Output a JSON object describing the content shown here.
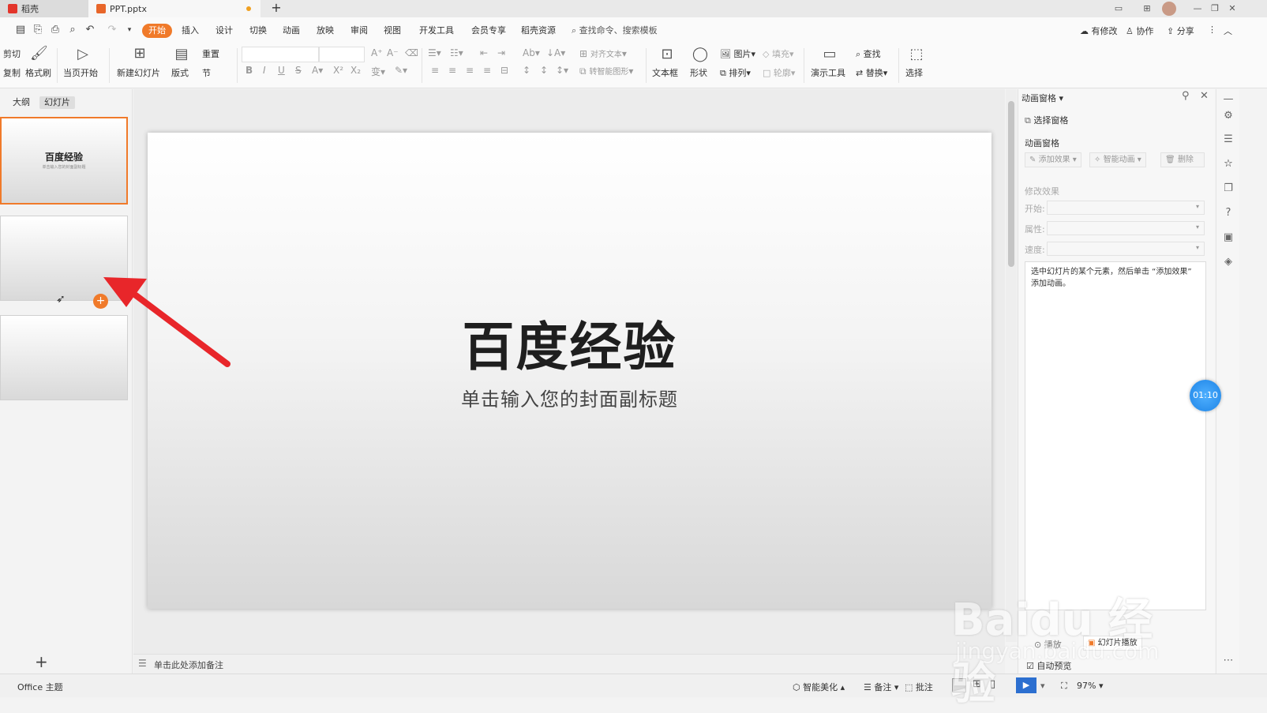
{
  "titlebar": {
    "home_tab": "稻壳",
    "doc_tab": "PPT.pptx",
    "new_tab": "+"
  },
  "menu": {
    "items": [
      "开始",
      "插入",
      "设计",
      "切换",
      "动画",
      "放映",
      "审阅",
      "视图",
      "开发工具",
      "会员专享",
      "稻壳资源"
    ],
    "active_index": 0,
    "search_placeholder": "查找命令、搜索模板",
    "right_links": [
      "有修改",
      "协作",
      "分享"
    ]
  },
  "ribbon": {
    "cut": "剪切",
    "copy": "复制",
    "format_painter": "格式刷",
    "play_from_current": "当页开始",
    "new_slide": "新建幻灯片",
    "layout": "版式",
    "reset": "重置",
    "section": "节",
    "align_text": "对齐文本",
    "smartart": "转智能图形",
    "textbox": "文本框",
    "shape": "形状",
    "picture": "图片",
    "fill": "填充",
    "arrange": "排列",
    "outline": "轮廓",
    "presenter_tools": "演示工具",
    "find": "查找",
    "replace": "替换",
    "select": "选择",
    "bold": "B",
    "italic": "I",
    "underline": "U",
    "strike": "S"
  },
  "leftpane": {
    "tab_outline": "大纲",
    "tab_slides": "幻灯片",
    "slide1_title": "百度经验",
    "slide1_subtitle": "单击输入您的封面副标题",
    "add_slide": "+"
  },
  "slide": {
    "title": "百度经验",
    "subtitle": "单击输入您的封面副标题"
  },
  "notes": {
    "placeholder": "单击此处添加备注"
  },
  "animpane": {
    "header": "动画窗格",
    "selection_pane": "选择窗格",
    "section_title": "动画窗格",
    "add_effect": "添加效果",
    "smart_anim": "智能动画",
    "delete": "删除",
    "modify_title": "修改效果",
    "start_label": "开始:",
    "property_label": "属性:",
    "speed_label": "速度:",
    "hint": "选中幻灯片的某个元素，然后单击 “添加效果” 添加动画。",
    "play": "播放",
    "slideshow_play": "幻灯片播放",
    "auto_preview": "自动预览"
  },
  "statusbar": {
    "theme": "Office 主题",
    "smart_beautify": "智能美化",
    "notes": "备注",
    "comments": "批注",
    "zoom": "97%"
  },
  "timer": "01:10",
  "watermark": {
    "brand": "Baidu 经验",
    "url": "jingyan.baidu.com"
  },
  "colors": {
    "accent": "#f07a2a",
    "arrow": "#e8262a",
    "timer": "#1e84e6"
  }
}
